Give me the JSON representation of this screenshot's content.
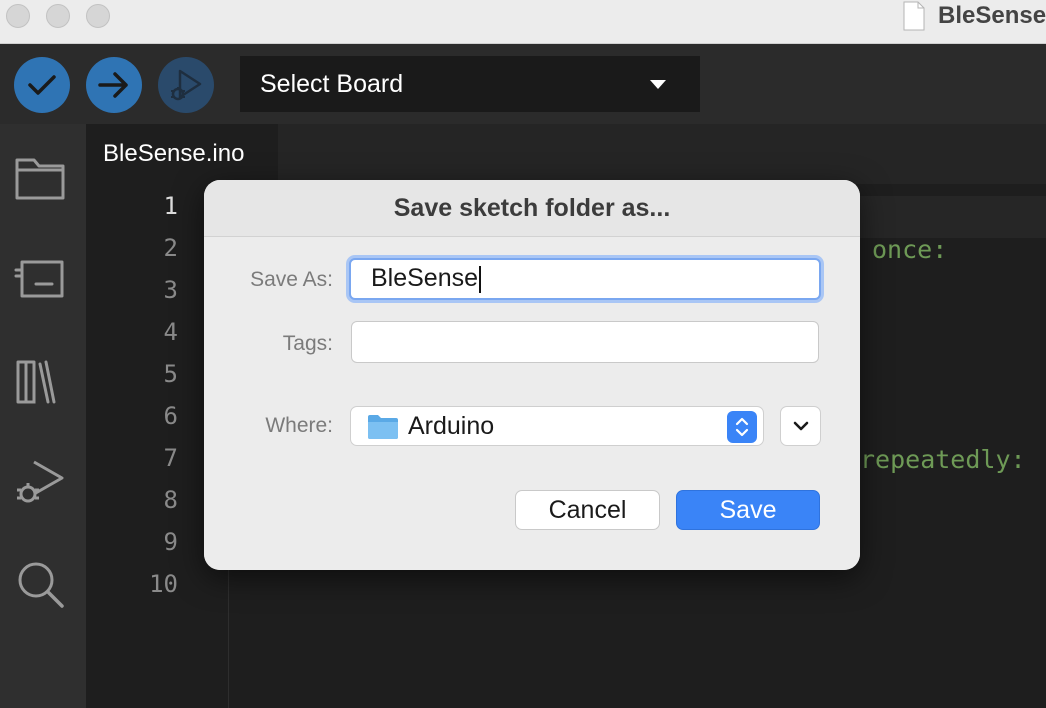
{
  "window": {
    "title": "BleSense",
    "traffic_lights": [
      "close",
      "minimize",
      "zoom"
    ]
  },
  "toolbar": {
    "buttons": [
      {
        "name": "verify",
        "icon": "checkmark-icon"
      },
      {
        "name": "upload",
        "icon": "arrow-right-icon"
      },
      {
        "name": "debug",
        "icon": "debug-play-icon"
      }
    ],
    "board_select": {
      "label": "Select Board",
      "icon": "caret-down-icon"
    }
  },
  "activity_bar": {
    "items": [
      {
        "name": "sketchbook",
        "icon": "folder-icon"
      },
      {
        "name": "boards-manager",
        "icon": "board-icon"
      },
      {
        "name": "library-manager",
        "icon": "library-icon"
      },
      {
        "name": "debug",
        "icon": "debug-icon"
      },
      {
        "name": "search",
        "icon": "search-icon"
      }
    ]
  },
  "editor": {
    "tab_label": "BleSense.ino",
    "line_numbers": [
      "1",
      "2",
      "3",
      "4",
      "5",
      "6",
      "7",
      "8",
      "9",
      "10"
    ],
    "active_line": "1",
    "visible_code_fragments": [
      "once:",
      "repeatedly:"
    ]
  },
  "dialog": {
    "title": "Save sketch folder as...",
    "save_as_label": "Save As:",
    "save_as_value": "BleSense",
    "tags_label": "Tags:",
    "tags_value": "",
    "where_label": "Where:",
    "where_value": "Arduino",
    "cancel_label": "Cancel",
    "save_label": "Save"
  },
  "colors": {
    "accent_blue": "#3a84f7",
    "toolbar_button_blue": "#2f74b4",
    "code_comment_green": "#6e9a56",
    "editor_background": "#1e1e1e"
  }
}
